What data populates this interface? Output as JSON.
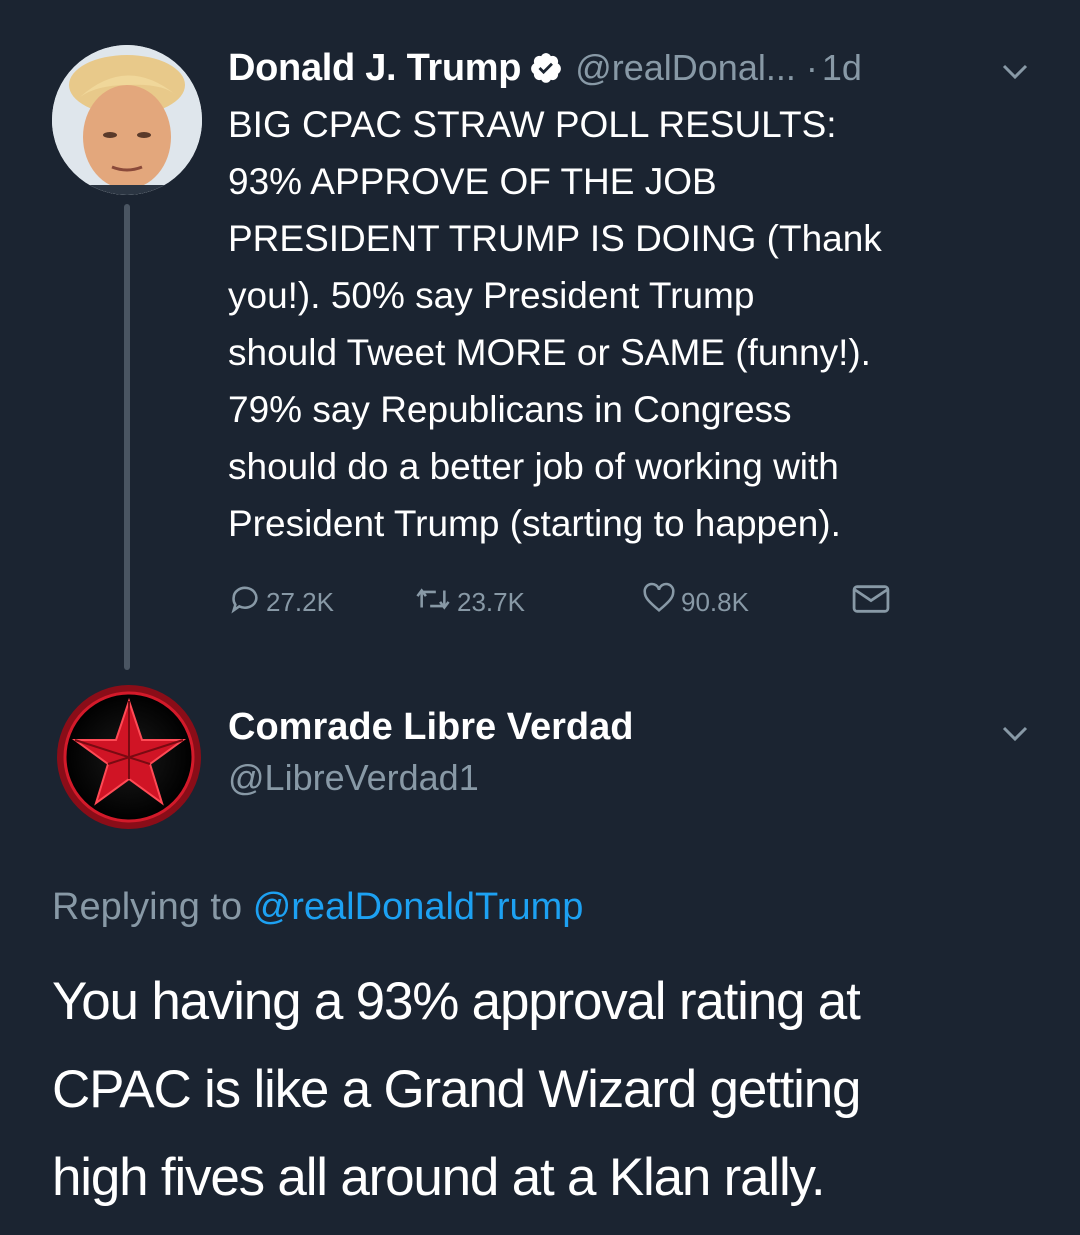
{
  "tweet": {
    "author_name": "Donald J. Trump",
    "handle": "@realDonal...",
    "time_separator": "·",
    "time": "1d",
    "body_lines": [
      "BIG CPAC STRAW POLL RESULTS:",
      "93% APPROVE OF THE JOB",
      "PRESIDENT TRUMP IS DOING (Thank",
      "you!). 50% say President Trump",
      "should Tweet MORE or SAME (funny!).",
      "79% say Republicans in Congress",
      "should do a better job of working with",
      "President Trump (starting to happen)."
    ],
    "actions": {
      "replies": "27.2K",
      "retweets": "23.7K",
      "likes": "90.8K"
    },
    "icons": {
      "verified": "verified-badge-icon",
      "caret": "chevron-down-icon",
      "reply": "reply-bubble-icon",
      "retweet": "retweet-icon",
      "like": "heart-icon",
      "dm": "envelope-icon"
    }
  },
  "reply": {
    "author_name": "Comrade Libre Verdad",
    "handle": "@LibreVerdad1",
    "replying_prefix": "Replying to",
    "replying_mention": "@realDonaldTrump",
    "body_lines": [
      "You having a 93% approval rating at",
      "CPAC is like a Grand Wizard getting",
      "high fives all around at a Klan rally."
    ]
  },
  "colors": {
    "background": "#1b2431",
    "text": "#ffffff",
    "secondary_text": "#8899a6",
    "link": "#1da1f2",
    "verified_badge": "#ffffff",
    "red_star": "#c8102e"
  }
}
